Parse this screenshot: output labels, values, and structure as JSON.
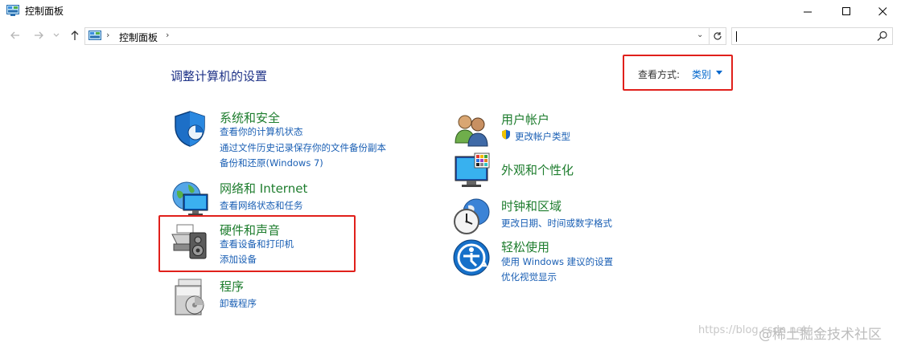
{
  "window": {
    "title": "控制面板",
    "minimize_glyph": "—",
    "maximize_glyph": "☐",
    "close_glyph": "✕"
  },
  "nav": {
    "back_icon": "back-arrow-icon",
    "forward_icon": "forward-arrow-icon",
    "up_icon": "up-arrow-icon",
    "breadcrumb": "控制面板",
    "search_placeholder": ""
  },
  "main": {
    "heading": "调整计算机的设置",
    "view_by_label": "查看方式:",
    "view_by_value": "类别"
  },
  "categories_left": [
    {
      "title": "系统和安全",
      "icon": "shield-icon",
      "links": [
        "查看你的计算机状态",
        "通过文件历史记录保存你的文件备份副本",
        "备份和还原(Windows 7)"
      ]
    },
    {
      "title": "网络和 Internet",
      "icon": "network-globe-icon",
      "links": [
        "查看网络状态和任务"
      ]
    },
    {
      "title": "硬件和声音",
      "icon": "printer-speaker-icon",
      "links": [
        "查看设备和打印机",
        "添加设备"
      ]
    },
    {
      "title": "程序",
      "icon": "programs-disc-icon",
      "links": [
        "卸载程序"
      ]
    }
  ],
  "categories_right": [
    {
      "title": "用户帐户",
      "icon": "users-icon",
      "links": [
        "更改帐户类型"
      ]
    },
    {
      "title": "外观和个性化",
      "icon": "monitor-palette-icon",
      "links": []
    },
    {
      "title": "时钟和区域",
      "icon": "clock-globe-icon",
      "links": [
        "更改日期、时间或数字格式"
      ]
    },
    {
      "title": "轻松使用",
      "icon": "ease-of-access-icon",
      "links": [
        "使用 Windows 建议的设置",
        "优化视觉显示"
      ]
    }
  ],
  "watermark": {
    "url": "https://blog.csdn.net/...",
    "brand": "@稀土掘金技术社区"
  },
  "colors": {
    "category_title": "#1e7d2e",
    "link": "#1a5fb4",
    "heading": "#1e3287",
    "highlight_box": "#e0201b"
  }
}
